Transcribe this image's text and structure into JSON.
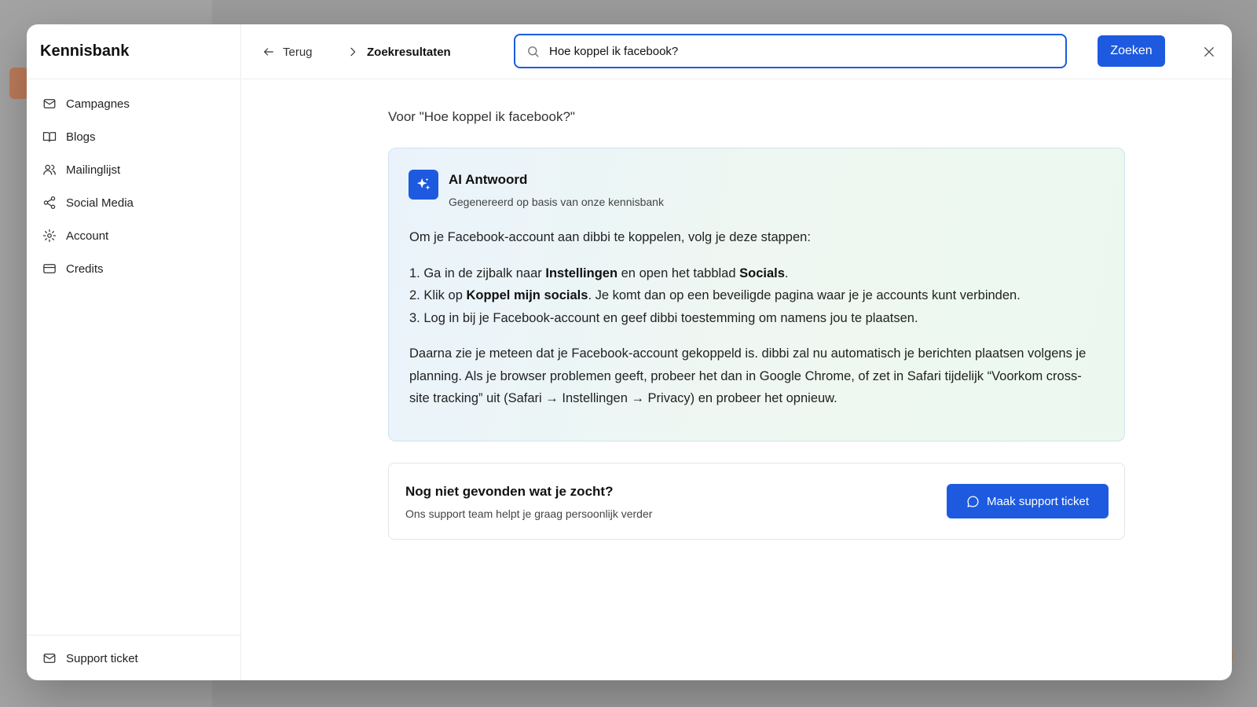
{
  "colors": {
    "accent": "#1d5ae0",
    "ai_card_bg_start": "#eaf3fb",
    "ai_card_bg_end": "#ecf8ef"
  },
  "sidebar": {
    "title": "Kennisbank",
    "items": [
      {
        "label": "Campagnes",
        "icon": "mail-icon"
      },
      {
        "label": "Blogs",
        "icon": "book-icon"
      },
      {
        "label": "Mailinglijst",
        "icon": "users-icon"
      },
      {
        "label": "Social Media",
        "icon": "share-icon"
      },
      {
        "label": "Account",
        "icon": "gear-icon"
      },
      {
        "label": "Credits",
        "icon": "credit-card-icon"
      }
    ],
    "footer": {
      "label": "Support ticket",
      "icon": "mail-icon"
    }
  },
  "topbar": {
    "back_label": "Terug",
    "breadcrumb": "Zoekresultaten",
    "search_value": "Hoe koppel ik facebook?",
    "search_button": "Zoeken"
  },
  "results": {
    "query_label": "Voor \"Hoe koppel ik facebook?\"",
    "ai_answer": {
      "title": "AI Antwoord",
      "subtitle": "Gegenereerd op basis van onze kennisbank",
      "intro": "Om je Facebook-account aan dibbi te koppelen, volg je deze stappen:",
      "steps": [
        {
          "prefix": "1. Ga in de zijbalk naar ",
          "bold1": "Instellingen",
          "mid": " en open het tabblad ",
          "bold2": "Socials",
          "suffix": "."
        },
        {
          "prefix": "2. Klik op ",
          "bold1": "Koppel mijn socials",
          "suffix": ". Je komt dan op een beveiligde pagina waar je je accounts kunt verbinden."
        },
        {
          "text": "3. Log in bij je Facebook-account en geef dibbi toestemming om namens jou te plaatsen."
        }
      ],
      "outro": "Daarna zie je meteen dat je Facebook-account gekoppeld is. dibbi zal nu automatisch je berichten plaatsen volgens je planning. Als je browser problemen geeft, probeer het dan in Google Chrome, of zet in Safari tijdelijk “Voorkom cross-site tracking” uit (Safari → Instellingen → Privacy) en probeer het opnieuw."
    },
    "help": {
      "title": "Nog niet gevonden wat je zocht?",
      "subtitle": "Ons support team helpt je graag persoonlijk verder",
      "button": "Maak support ticket"
    }
  }
}
